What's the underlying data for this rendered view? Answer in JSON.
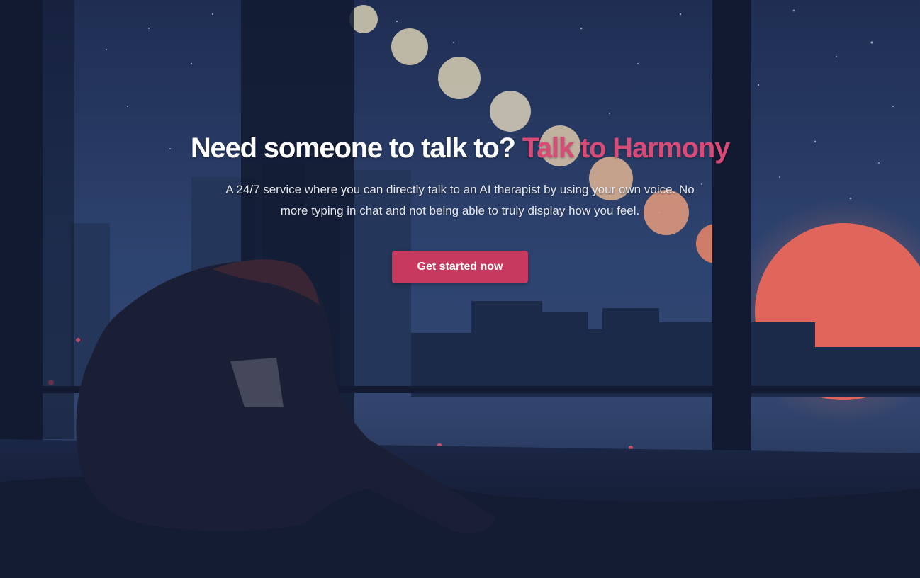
{
  "hero": {
    "headline_main": "Need someone to talk to?",
    "headline_accent": "Talk to Harmony",
    "subtitle": "A 24/7 service where you can directly talk to an AI therapist by using your own voice. No more typing in chat and not being able to truly display how you feel.",
    "cta_label": "Get started now"
  },
  "colors": {
    "accent": "#d94b77",
    "button": "#c8395f",
    "night_sky": "#263a63",
    "sun": "#e0665c"
  }
}
